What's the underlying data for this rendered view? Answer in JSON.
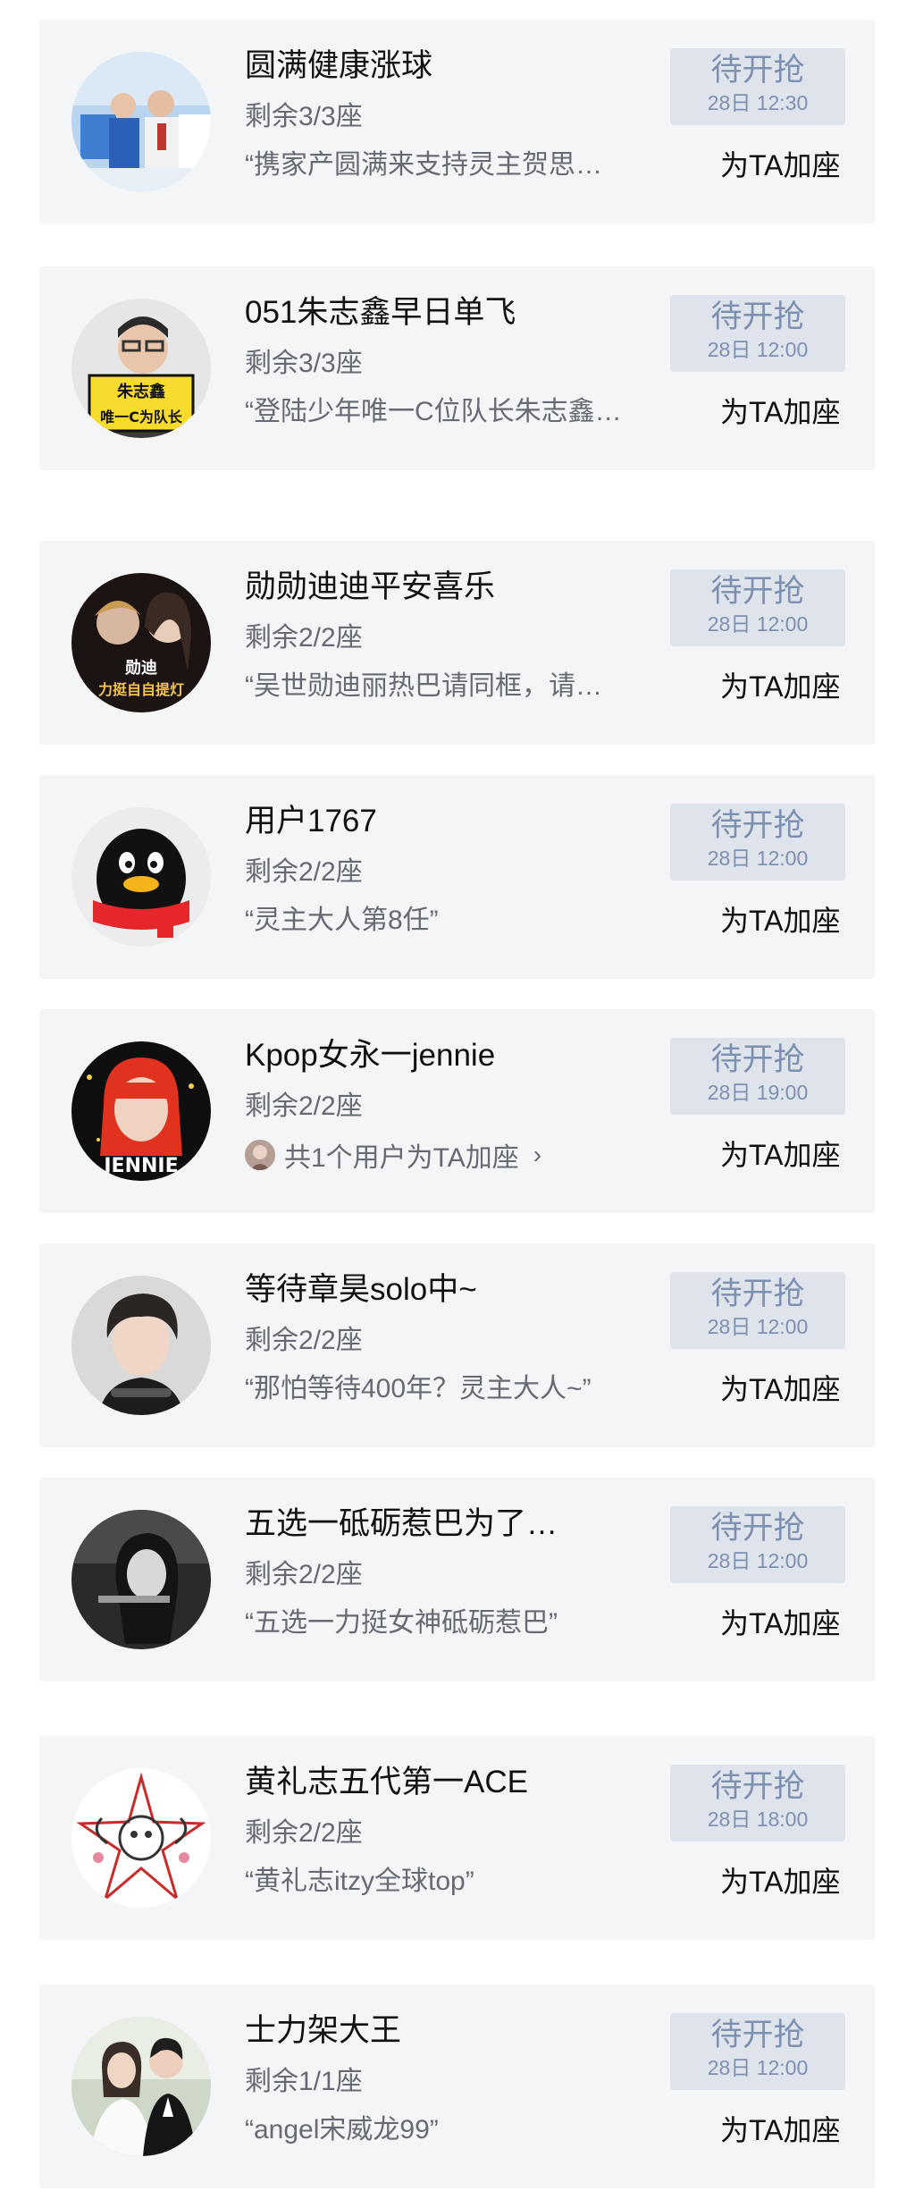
{
  "colors": {
    "card_bg": "#f4f5f7",
    "status_bg": "#dfe3ec",
    "status_text": "#7e90b1",
    "primary_text": "#111111",
    "secondary_text": "#666a73"
  },
  "add_seat_label": "为TA加座",
  "status_label": "待开抢",
  "items": [
    {
      "name": "圆满健康涨球",
      "seats": "剩余3/3座",
      "quote": "“携家产圆满来支持灵主贺思…",
      "status_time": "28日 12:30",
      "avatar": "athletes-photo"
    },
    {
      "name": "051朱志鑫早日单飞",
      "seats": "剩余3/3座",
      "quote": "“登陆少年唯一C位队长朱志鑫…",
      "status_time": "28日 12:00",
      "avatar": "person-with-sign-photo",
      "avatar_text_1": "朱志鑫",
      "avatar_text_2": "唯一C为队长"
    },
    {
      "name": "勋勋迪迪平安喜乐",
      "seats": "剩余2/2座",
      "quote": "“吴世勋迪丽热巴请同框，请…",
      "status_time": "28日 12:00",
      "avatar": "couple-collage-photo",
      "avatar_text_1": "勋迪",
      "avatar_text_2": "力挺自自提灯"
    },
    {
      "name": "用户1767",
      "seats": "剩余2/2座",
      "quote": "“灵主大人第8任”",
      "status_time": "28日 12:00",
      "avatar": "qq-penguin-icon"
    },
    {
      "name": "Kpop女永一jennie",
      "seats": "剩余2/2座",
      "boost_text": "共1个用户为TA加座",
      "status_time": "28日 19:00",
      "avatar": "jennie-red-hair-photo",
      "avatar_text_1": "JENNIE"
    },
    {
      "name": "等待章昊solo中~",
      "seats": "剩余2/2座",
      "quote": "“那怕等待400年？灵主大人~”",
      "status_time": "28日 12:00",
      "avatar": "young-man-photo"
    },
    {
      "name": "五选一砥砺惹巴为了…",
      "seats": "剩余2/2座",
      "quote": "“五选一力挺女神砥砺惹巴”",
      "status_time": "28日 12:00",
      "avatar": "woman-bw-photo"
    },
    {
      "name": "黄礼志五代第一ACE",
      "seats": "剩余2/2座",
      "quote": "“黄礼志itzy全球top”",
      "status_time": "28日 18:00",
      "avatar": "red-sketch-emblem"
    },
    {
      "name": "士力架大王",
      "seats": "剩余1/1座",
      "quote": "“angel宋威龙99”",
      "status_time": "28日 12:00",
      "avatar": "wedding-couple-photo"
    }
  ]
}
